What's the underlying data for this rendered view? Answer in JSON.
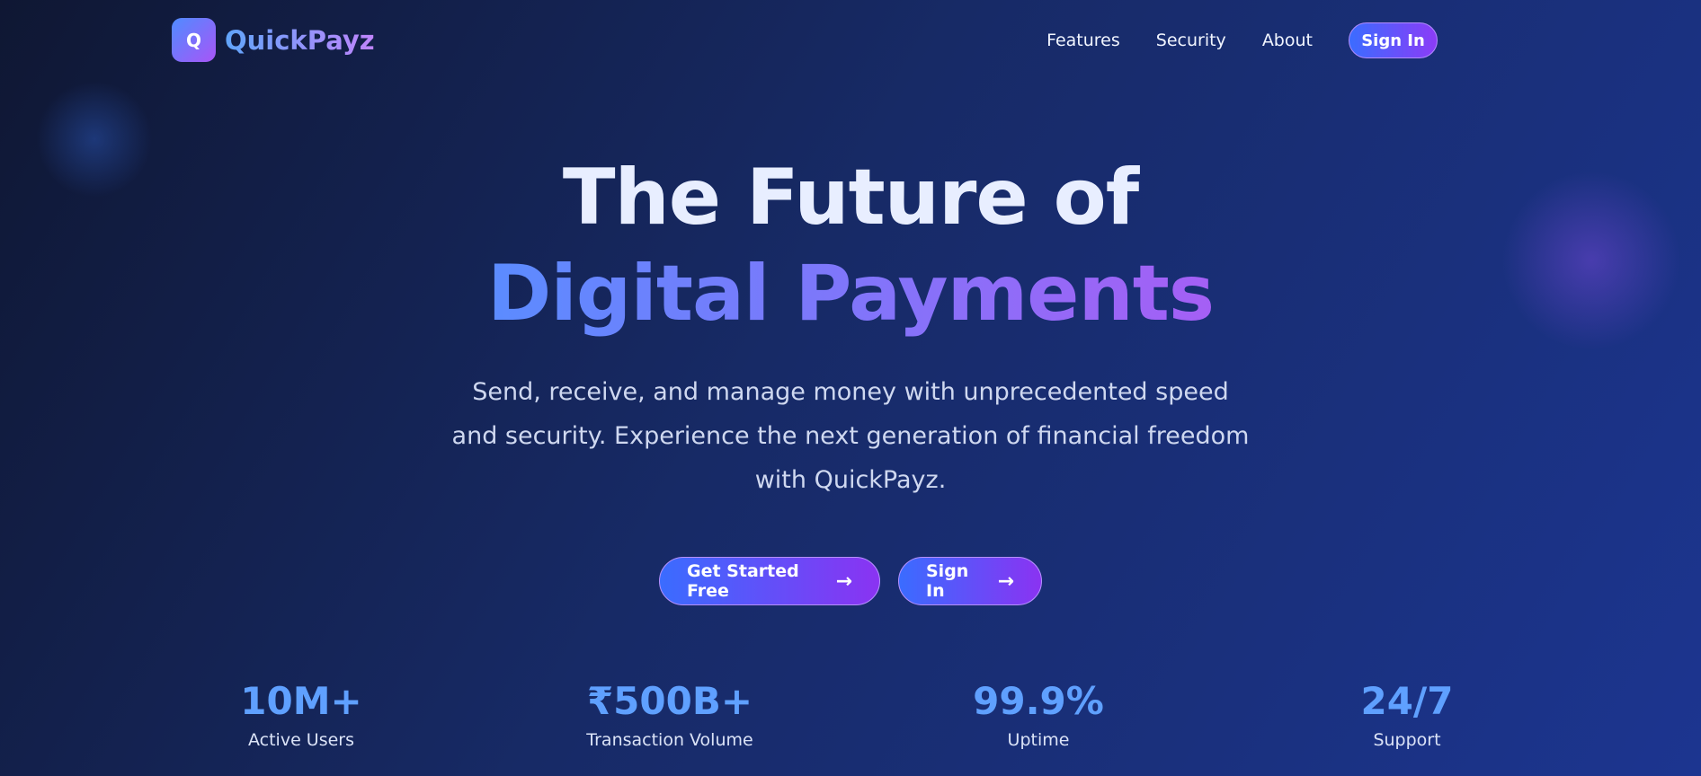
{
  "brand": {
    "logo_letter": "Q",
    "name": "QuickPayz"
  },
  "nav": {
    "links": [
      "Features",
      "Security",
      "About"
    ],
    "signin_label": "Sign In"
  },
  "hero": {
    "title_line1": "The Future of",
    "title_line2": "Digital Payments",
    "subtitle": "Send, receive, and manage money with unprecedented speed and security. Experience the next generation of financial freedom with QuickPayz."
  },
  "cta": {
    "primary_label": "Get Started Free",
    "secondary_label": "Sign In",
    "arrow": "→"
  },
  "stats": [
    {
      "value": "10M+",
      "label": "Active Users"
    },
    {
      "value": "₹500B+",
      "label": "Transaction Volume"
    },
    {
      "value": "99.9%",
      "label": "Uptime"
    },
    {
      "value": "24/7",
      "label": "Support"
    }
  ],
  "colors": {
    "accent_start": "#3b6cff",
    "accent_end": "#8b3cf7",
    "stat_value": "#5fa0ff"
  }
}
